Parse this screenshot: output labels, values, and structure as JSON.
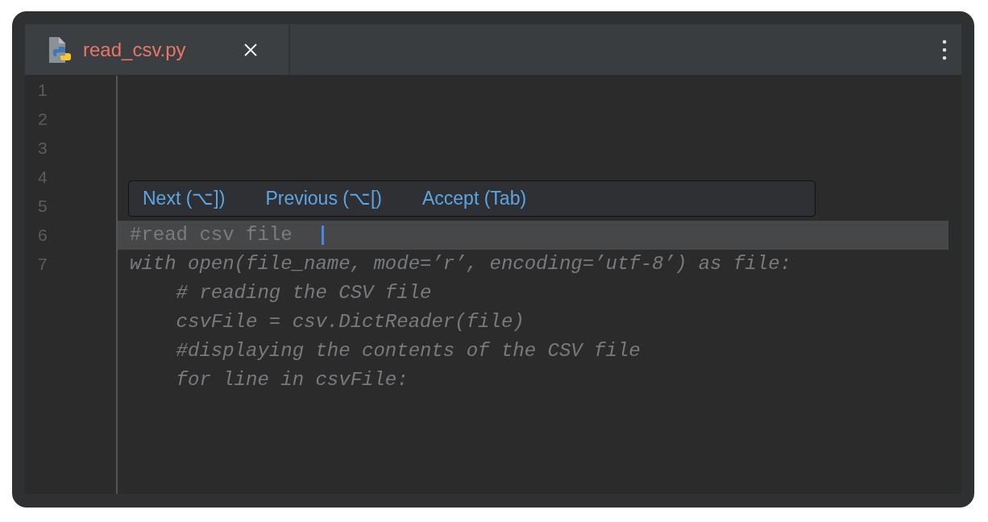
{
  "tabs": [
    {
      "label": "read_csv.py",
      "selected": true
    }
  ],
  "hint_bar": {
    "actions": [
      "Next (⌥])",
      "Previous (⌥[)",
      "Accept (Tab)"
    ]
  },
  "editor": {
    "lines": [
      {
        "number": "1"
      },
      {
        "number": "2"
      },
      {
        "number": "3"
      },
      {
        "number": "4"
      },
      {
        "number": "5"
      },
      {
        "number": "6",
        "kind": "code",
        "text": "#read csv file",
        "current": true
      },
      {
        "number": "7",
        "kind": "suggestion",
        "text": "with open(file_name, mode=’r’, encoding=’utf-8’) as file:"
      },
      {
        "kind": "suggestion",
        "text": "    # reading the CSV file"
      },
      {
        "kind": "suggestion",
        "text": "    csvFile = csv.DictReader(file)"
      },
      {
        "kind": "suggestion",
        "text": "    #displaying the contents of the CSV file"
      },
      {
        "kind": "suggestion",
        "text": "    for line in csvFile:"
      }
    ]
  }
}
